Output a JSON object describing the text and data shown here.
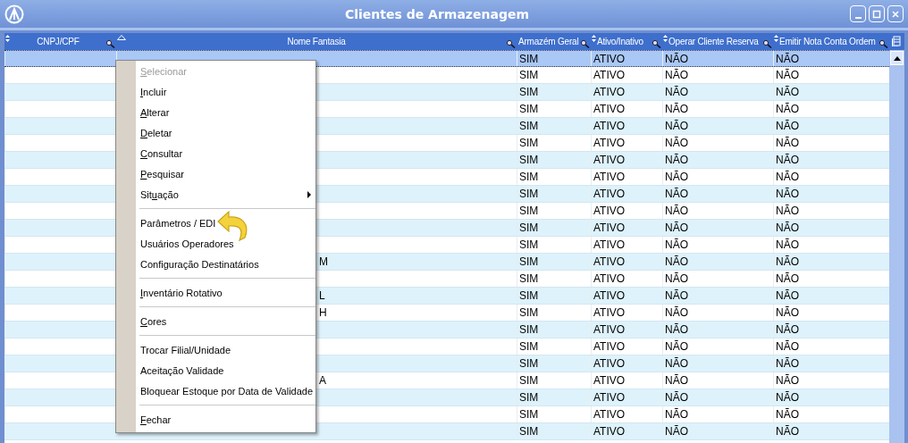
{
  "window": {
    "title": "Clientes de Armazenagem"
  },
  "table": {
    "columns": [
      {
        "label": "CNPJ/CPF",
        "sortable": true,
        "searchable": true,
        "sorted": false
      },
      {
        "label": "Nome Fantasia",
        "sortable": false,
        "searchable": true,
        "sorted": true
      },
      {
        "label": "Armazém Geral",
        "sortable": false,
        "searchable": true,
        "sorted": false
      },
      {
        "label": "Ativo/Inativo",
        "sortable": true,
        "searchable": true,
        "sorted": false
      },
      {
        "label": "Operar Cliente Reserva",
        "sortable": true,
        "searchable": true,
        "sorted": false
      },
      {
        "label": "Emitir Nota Conta Ordem",
        "sortable": true,
        "searchable": true,
        "sorted": false
      }
    ],
    "rows": [
      {
        "selected": true,
        "armazem": "SIM",
        "ativo": "ATIVO",
        "operar": "NÃO",
        "emitir": "NÃO"
      },
      {
        "selected": false,
        "armazem": "SIM",
        "ativo": "ATIVO",
        "operar": "NÃO",
        "emitir": "NÃO"
      },
      {
        "selected": false,
        "armazem": "SIM",
        "ativo": "ATIVO",
        "operar": "NÃO",
        "emitir": "NÃO"
      },
      {
        "selected": false,
        "armazem": "SIM",
        "ativo": "ATIVO",
        "operar": "NÃO",
        "emitir": "NÃO"
      },
      {
        "selected": false,
        "armazem": "SIM",
        "ativo": "ATIVO",
        "operar": "NÃO",
        "emitir": "NÃO"
      },
      {
        "selected": false,
        "armazem": "SIM",
        "ativo": "ATIVO",
        "operar": "NÃO",
        "emitir": "NÃO"
      },
      {
        "selected": false,
        "armazem": "SIM",
        "ativo": "ATIVO",
        "operar": "NÃO",
        "emitir": "NÃO"
      },
      {
        "selected": false,
        "armazem": "SIM",
        "ativo": "ATIVO",
        "operar": "NÃO",
        "emitir": "NÃO"
      },
      {
        "selected": false,
        "armazem": "SIM",
        "ativo": "ATIVO",
        "operar": "NÃO",
        "emitir": "NÃO"
      },
      {
        "selected": false,
        "armazem": "SIM",
        "ativo": "ATIVO",
        "operar": "NÃO",
        "emitir": "NÃO"
      },
      {
        "selected": false,
        "armazem": "SIM",
        "ativo": "ATIVO",
        "operar": "NÃO",
        "emitir": "NÃO"
      },
      {
        "selected": false,
        "armazem": "SIM",
        "ativo": "ATIVO",
        "operar": "NÃO",
        "emitir": "NÃO"
      },
      {
        "selected": false,
        "name_fragment": "M",
        "armazem": "SIM",
        "ativo": "ATIVO",
        "operar": "NÃO",
        "emitir": "NÃO"
      },
      {
        "selected": false,
        "armazem": "SIM",
        "ativo": "ATIVO",
        "operar": "NÃO",
        "emitir": "NÃO"
      },
      {
        "selected": false,
        "name_fragment": "L",
        "armazem": "SIM",
        "ativo": "ATIVO",
        "operar": "NÃO",
        "emitir": "NÃO"
      },
      {
        "selected": false,
        "name_fragment": "H",
        "armazem": "SIM",
        "ativo": "ATIVO",
        "operar": "NÃO",
        "emitir": "NÃO"
      },
      {
        "selected": false,
        "armazem": "SIM",
        "ativo": "ATIVO",
        "operar": "NÃO",
        "emitir": "NÃO"
      },
      {
        "selected": false,
        "armazem": "SIM",
        "ativo": "ATIVO",
        "operar": "NÃO",
        "emitir": "NÃO"
      },
      {
        "selected": false,
        "armazem": "SIM",
        "ativo": "ATIVO",
        "operar": "NÃO",
        "emitir": "NÃO"
      },
      {
        "selected": false,
        "name_fragment": "A",
        "armazem": "SIM",
        "ativo": "ATIVO",
        "operar": "NÃO",
        "emitir": "NÃO"
      },
      {
        "selected": false,
        "armazem": "SIM",
        "ativo": "ATIVO",
        "operar": "NÃO",
        "emitir": "NÃO"
      },
      {
        "selected": false,
        "armazem": "SIM",
        "ativo": "ATIVO",
        "operar": "NÃO",
        "emitir": "NÃO"
      },
      {
        "selected": false,
        "armazem": "SIM",
        "ativo": "ATIVO",
        "operar": "NÃO",
        "emitir": "NÃO"
      }
    ]
  },
  "context_menu": {
    "groups": [
      [
        {
          "mnemonic": "S",
          "after": "elecionar",
          "disabled": true,
          "submenu": false
        },
        {
          "mnemonic": "I",
          "after": "ncluir",
          "disabled": false,
          "submenu": false
        },
        {
          "mnemonic": "A",
          "after": "lterar",
          "disabled": false,
          "submenu": false
        },
        {
          "mnemonic": "D",
          "after": "eletar",
          "disabled": false,
          "submenu": false
        },
        {
          "mnemonic": "C",
          "after": "onsultar",
          "disabled": false,
          "submenu": false
        },
        {
          "mnemonic": "P",
          "after": "esquisar",
          "disabled": false,
          "submenu": false
        },
        {
          "before": "Sit",
          "mnemonic": "u",
          "after": "ação",
          "disabled": false,
          "submenu": true
        }
      ],
      [
        {
          "before": "Parâmetros / EDI",
          "disabled": false,
          "submenu": false
        },
        {
          "before": "Usuários Operadores",
          "disabled": false,
          "submenu": false
        },
        {
          "before": "Configuração Destinatários",
          "disabled": false,
          "submenu": false
        }
      ],
      [
        {
          "mnemonic": "I",
          "after": "nventário Rotativo",
          "disabled": false,
          "submenu": false
        }
      ],
      [
        {
          "mnemonic": "C",
          "after": "ores",
          "disabled": false,
          "submenu": false
        }
      ],
      [
        {
          "before": "Trocar Filial/Unidade",
          "disabled": false,
          "submenu": false
        },
        {
          "before": "Aceitação Validade",
          "disabled": false,
          "submenu": false
        },
        {
          "before": "Bloquear Estoque por Data de Validade",
          "disabled": false,
          "submenu": false
        }
      ],
      [
        {
          "mnemonic": "F",
          "after": "echar",
          "disabled": false,
          "submenu": false
        }
      ]
    ]
  }
}
